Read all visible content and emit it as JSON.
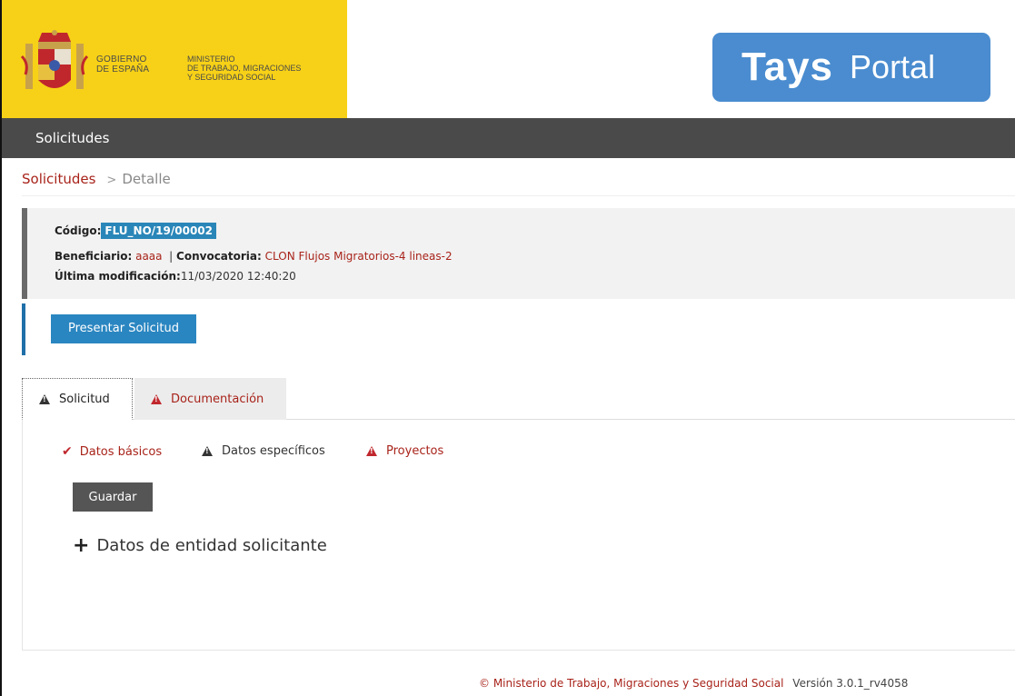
{
  "header": {
    "gov_line1": "GOBIERNO",
    "gov_line2": "DE ESPAÑA",
    "ministry_line1": "MINISTERIO",
    "ministry_line2": "DE TRABAJO, MIGRACIONES",
    "ministry_line3": "Y SEGURIDAD SOCIAL",
    "portal_name": "Tays",
    "portal_suffix": "Portal"
  },
  "nav": {
    "item": "Solicitudes"
  },
  "breadcrumb": {
    "link": "Solicitudes",
    "separator": ">",
    "current": "Detalle"
  },
  "info": {
    "code_label": "Código:",
    "code_value": "FLU_NO/19/00002",
    "beneficiary_label": "Beneficiario:",
    "beneficiary_value": "aaaa",
    "divider": "|",
    "call_label": "Convocatoria:",
    "call_value": "CLON Flujos Migratorios-4 lineas-2",
    "modified_label": "Última modificación:",
    "modified_value": "11/03/2020 12:40:20"
  },
  "actions": {
    "submit_label": "Presentar Solicitud"
  },
  "tabs": [
    {
      "label": "Solicitud",
      "icon": "warning-icon",
      "active": true
    },
    {
      "label": "Documentación",
      "icon": "warning-icon",
      "active": false
    }
  ],
  "subnav": [
    {
      "label": "Datos básicos",
      "icon": "check-icon"
    },
    {
      "label": "Datos específicos",
      "icon": "warning-icon"
    },
    {
      "label": "Proyectos",
      "icon": "warning-icon"
    }
  ],
  "form": {
    "save_label": "Guardar",
    "section_title": "Datos de entidad solicitante"
  },
  "footer": {
    "copyright": "© Ministerio de Trabajo, Migraciones y Seguridad Social",
    "version": "Versión 3.0.1_rv4058"
  },
  "colors": {
    "gov_yellow": "#f7d117",
    "portal_blue": "#4a8ccf",
    "nav_gray": "#4a4a4a",
    "link_red": "#a8231a",
    "badge_blue": "#2a86b8",
    "button_blue": "#2a86c1"
  }
}
